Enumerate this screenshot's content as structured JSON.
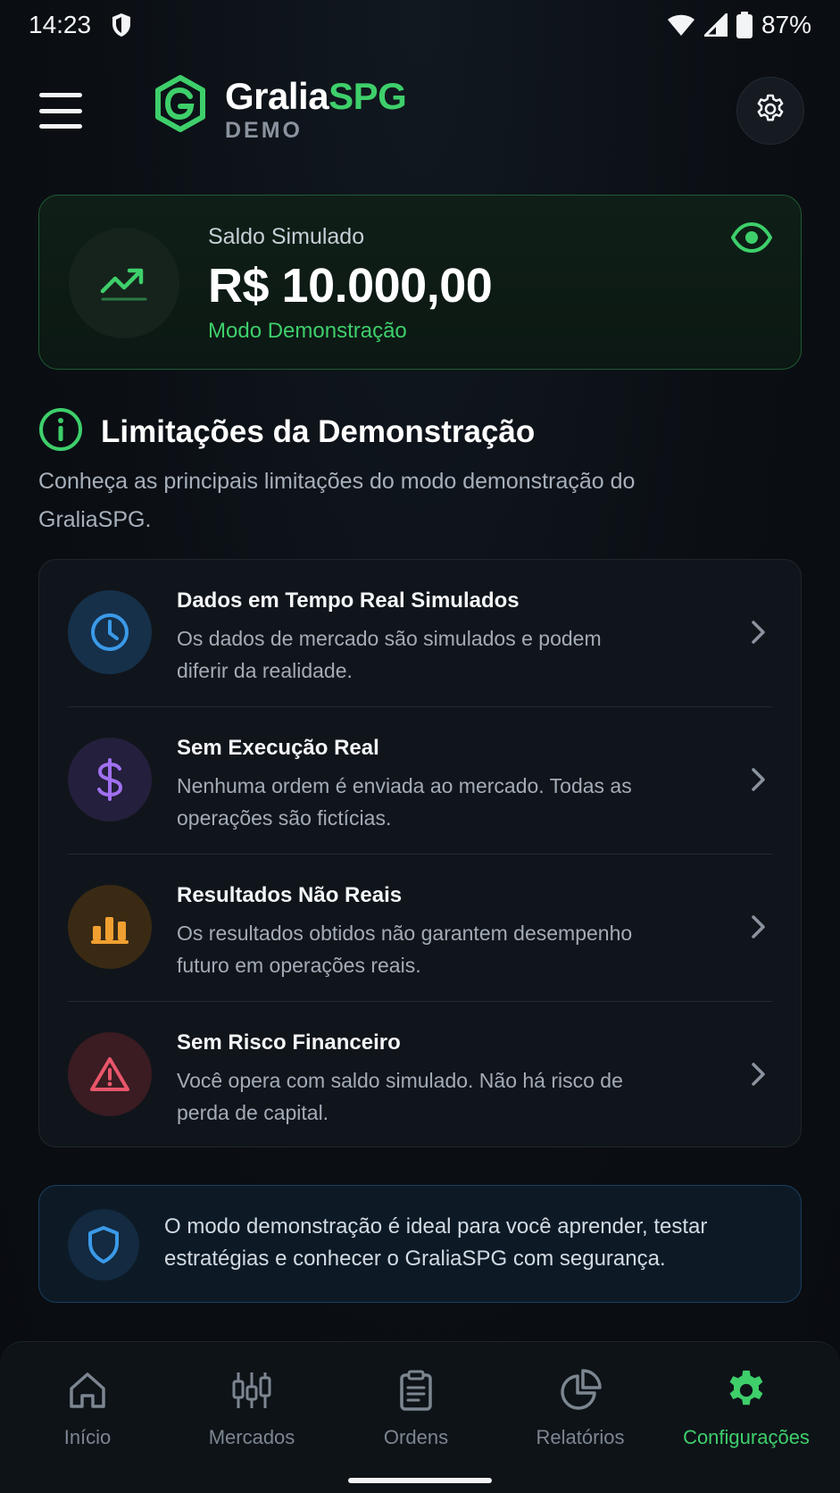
{
  "status_bar": {
    "time": "14:23",
    "battery": "87%",
    "icons": [
      "shield-icon",
      "wifi-icon",
      "signal-icon",
      "battery-icon"
    ]
  },
  "header": {
    "brand_primary": "Gralia",
    "brand_accent": "SPG",
    "brand_sub": "DEMO",
    "icons": [
      "menu-icon",
      "logo-icon",
      "gear-icon"
    ]
  },
  "balance": {
    "label": "Saldo Simulado",
    "amount": "R$ 10.000,00",
    "mode": "Modo Demonstração",
    "icons": [
      "trending-up-icon",
      "eye-icon"
    ]
  },
  "limitations": {
    "title": "Limitações da Demonstração",
    "description": "Conheça as principais limitações do modo demonstração do GraliaSPG.",
    "items": [
      {
        "title": "Dados em Tempo Real Simulados",
        "description": "Os dados de mercado são simulados e podem diferir da realidade.",
        "icon": "clock-icon",
        "color": "#3b9ae8"
      },
      {
        "title": "Sem Execução Real",
        "description": "Nenhuma ordem é enviada ao mercado. Todas as operações são fictícias.",
        "icon": "dollar-icon",
        "color": "#a070f0"
      },
      {
        "title": "Resultados Não Reais",
        "description": "Os resultados obtidos não garantem desempenho futuro em operações reais.",
        "icon": "bar-chart-icon",
        "color": "#f0a030"
      },
      {
        "title": "Sem Risco Financeiro",
        "description": "Você opera com saldo simulado. Não há risco de perda de capital.",
        "icon": "warning-icon",
        "color": "#e8566a"
      }
    ]
  },
  "info_banner": {
    "text": "O modo demonstração é ideal para você aprender, testar estratégias e conhecer o GraliaSPG com segurança.",
    "icon": "shield-icon"
  },
  "bottom_nav": {
    "items": [
      {
        "label": "Início",
        "icon": "home-icon"
      },
      {
        "label": "Mercados",
        "icon": "candlestick-icon"
      },
      {
        "label": "Ordens",
        "icon": "clipboard-icon"
      },
      {
        "label": "Relatórios",
        "icon": "pie-chart-icon"
      },
      {
        "label": "Configurações",
        "icon": "gear-icon"
      }
    ],
    "active_index": 4
  },
  "colors": {
    "accent": "#3ecf6b",
    "background": "#0b0f14"
  }
}
